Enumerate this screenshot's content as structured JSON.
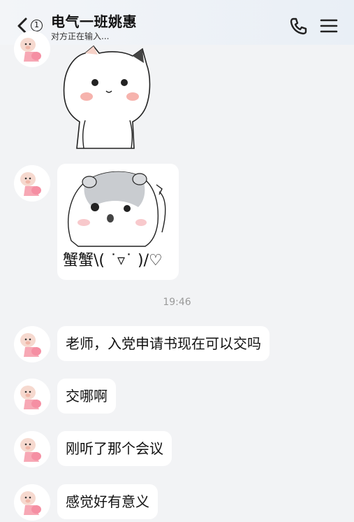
{
  "header": {
    "title": "电气一班姚惠",
    "status": "对方正在输入...",
    "unread_count": "1"
  },
  "messages": {
    "sticker_caption": "蟹蟹\\( ˙▿˙ )/♡",
    "timestamp": "19:46",
    "texts": [
      "老师，入党申请书现在可以交吗",
      "交哪啊",
      "刚听了那个会议",
      "感觉好有意义"
    ]
  },
  "colors": {
    "background": "#f2f3f5",
    "bubble": "#ffffff",
    "timestamp": "#9a9a9a"
  },
  "icons": [
    "back-icon",
    "phone-icon",
    "menu-icon",
    "pig-avatar-icon",
    "cat-sticker",
    "hamster-sticker"
  ]
}
